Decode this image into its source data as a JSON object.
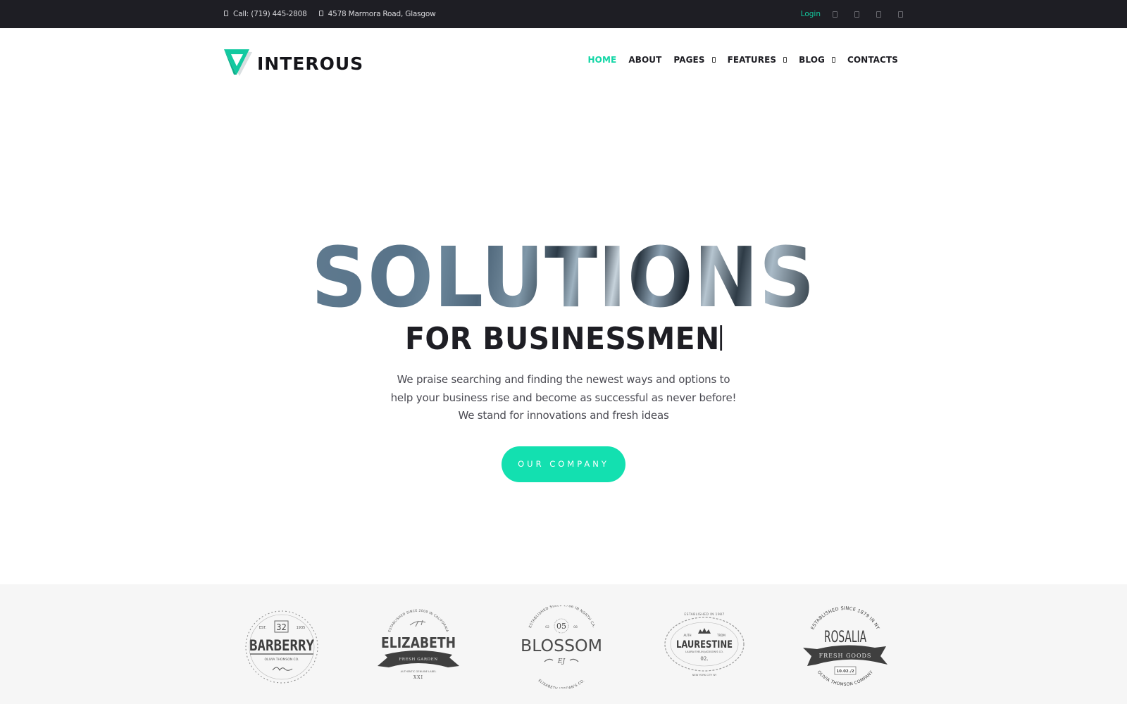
{
  "topbar": {
    "phone": "Call: (719) 445-2808",
    "address": "4578 Marmora Road, Glasgow",
    "login_label": "Login",
    "social_icons": [
      "facebook-icon",
      "twitter-icon",
      "google-plus-icon",
      "instagram-icon"
    ]
  },
  "header": {
    "logo_text": "INTEROUS",
    "nav": [
      {
        "label": "HOME",
        "active": true,
        "dropdown": false
      },
      {
        "label": "ABOUT",
        "active": false,
        "dropdown": false
      },
      {
        "label": "PAGES",
        "active": false,
        "dropdown": true
      },
      {
        "label": "FEATURES",
        "active": false,
        "dropdown": true
      },
      {
        "label": "BLOG",
        "active": false,
        "dropdown": true
      },
      {
        "label": "CONTACTS",
        "active": false,
        "dropdown": false
      }
    ]
  },
  "hero": {
    "title": "SOLUTIONS",
    "subtitle": "FOR BUSINESSMEN",
    "text": "We praise searching and finding the newest ways and options to help your business rise and become as successful as never before! We stand for innovations and fresh ideas",
    "button_label": "OUR COMPANY"
  },
  "clients": [
    {
      "name": "BARBERRY",
      "top": "32",
      "left_tag": "EST.",
      "right_tag": "1935",
      "sub": "OLIVIA THOMSON CO."
    },
    {
      "name": "ELIZABETH",
      "arc": "ESTABLISHED SINCE 2009 IN CALIFORNIA",
      "ribbon": "FRESH GARDEN",
      "sub": "AUTHENTIC GENUINE LABEL",
      "foot": "XXI"
    },
    {
      "name": "BLOSSOM",
      "arc": "ESTABLISHED SINCE 1786 IN NORTH CA.",
      "num": "05",
      "left_tag": "02",
      "right_tag": "08",
      "sub": "ELISABETH JORDAN'S CO.",
      "mono": "EJ"
    },
    {
      "name": "LAURESTINE",
      "arc": "ESTABLISHED IN 1987",
      "left_tag": "AUTH",
      "right_tag": "TRDM",
      "sub": "LAURA EVELIN JACKSON'S CO.",
      "num": "02.",
      "foot": "NEW YORK CITY NY"
    },
    {
      "name": "ROSALIA",
      "arc": "ESTABLISHED SINCE 1879 IN NY",
      "ribbon": "FRESH GOODS",
      "num": "10.02./2",
      "sub": "OLIVIA THOMSON COMPANY"
    }
  ],
  "colors": {
    "accent": "#13e0b0",
    "accent_text": "#13d6a6",
    "topbar_bg": "#1e1e24",
    "clients_bg": "#f6f6f6"
  }
}
